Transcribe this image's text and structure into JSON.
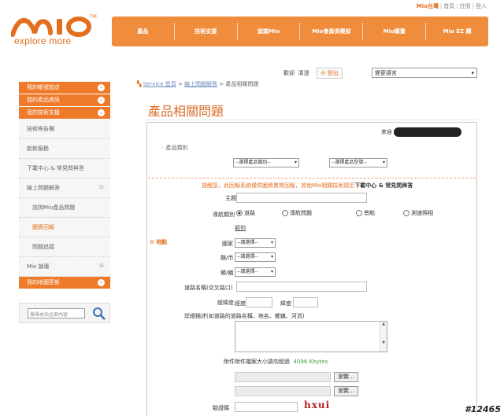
{
  "top_links": {
    "region": "Mio台灣",
    "home": "首頁",
    "register": "註冊",
    "login": "登入"
  },
  "logo": {
    "tagline": "explore more"
  },
  "main_nav": [
    "產品",
    "技術支援",
    "認識Mio",
    "Mio會員俱樂部",
    "Mio購賣",
    "Mio EZ 購"
  ],
  "user_bar": {
    "welcome": "歡迎",
    "user": "清澄",
    "logout": "登出",
    "language_select": "變更語言"
  },
  "sidebar": {
    "my_settings": "我的帳號設定",
    "my_products": "我的產品資訊",
    "my_support": "我的技術支援",
    "tech_news": "技術佈告欄",
    "repair": "創新服務",
    "download_faq": "下載中心 & 常見問與答",
    "online_faq": "線上問題解答",
    "ask_product": "諮詢Mio產品問題",
    "map_report": "圖資回報",
    "history": "問題追蹤",
    "mio_club": "Mio 論壇",
    "map_update": "我的地圖更新",
    "search_placeholder": "搜尋本站全部內容"
  },
  "breadcrumb": {
    "home": "Service 首頁",
    "online": "線上問題解答",
    "current": "產品相關問題"
  },
  "page_title": "產品相關問題",
  "form": {
    "from_label": "來自",
    "product_category": "產品類別",
    "category_select": "--選擇產品類別--",
    "model_select": "--選擇產品型號--",
    "notice_text": "提醒您，此回報系統僅供圖資異常回報，其他Mio相關技術請至",
    "notice_link": "下載中心 & 常見問與答",
    "subject_label": "主題",
    "nav_type_label": "導航類別",
    "radio_road": "道路",
    "radio_nav": "導航問題",
    "radio_poi": "景點",
    "radio_speed": "測速照相",
    "example": "範例",
    "address_tag": "地點",
    "country_label": "國家",
    "country_select": "--請選擇--",
    "city_label": "縣/市",
    "city_select": "--請選擇--",
    "town_label": "鄉/鎮",
    "town_select": "--請選擇--",
    "road_label": "道路名稱(交叉路口)",
    "coords_label": "經緯度",
    "lng_label": "經度",
    "lat_label": "緯度",
    "desc_label": "詳細描述(如道路的道路名稱、地名、鄉鎮、河流)",
    "upload_note": "附件附件檔案大小請勿超過",
    "upload_size": "4096 Kbytes",
    "browse_1": "瀏覽...",
    "browse_2": "瀏覽...",
    "captcha_label": "驗證碼",
    "captcha_text": "hxui"
  },
  "watermark": "#12465",
  "colors": {
    "accent": "#ee7a2a",
    "nav_bg": "#f08d3c",
    "title": "#d96b2a"
  }
}
